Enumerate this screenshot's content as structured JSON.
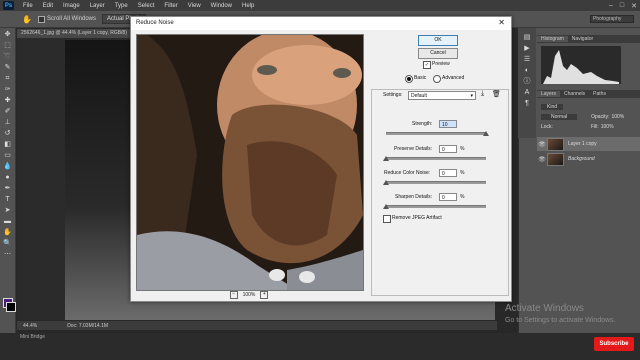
{
  "menubar": {
    "logo": "Ps",
    "items": [
      "File",
      "Edit",
      "Image",
      "Layer",
      "Type",
      "Select",
      "Filter",
      "View",
      "Window",
      "Help"
    ],
    "window_controls": [
      "–",
      "□",
      "✕"
    ]
  },
  "options": {
    "scroll_all": "Scroll All Windows",
    "actual_pixels": "Actual Pixels",
    "workspace": "Photography"
  },
  "document": {
    "tab": "2562646_1.jpg @ 44.4% (Layer 1 copy, RGB/8)",
    "zoom": "44.4%",
    "doc_size": "Doc: 7.03M/14.1M",
    "mini_bridge": "Mini Bridge"
  },
  "panels": {
    "histogram_tabs": [
      "Histogram",
      "Navigator"
    ],
    "layers_tabs": [
      "Layers",
      "Channels",
      "Paths"
    ],
    "kind": "Kind",
    "blend": "Normal",
    "opacity_label": "Opacity:",
    "opacity": "100%",
    "lock_label": "Lock:",
    "fill_label": "Fill:",
    "fill": "100%",
    "layers": [
      "Layer 1 copy",
      "Background"
    ]
  },
  "dialog": {
    "title": "Reduce Noise",
    "close": "✕",
    "ok": "OK",
    "cancel": "Cancel",
    "preview": "Preview",
    "basic": "Basic",
    "advanced": "Advanced",
    "settings_label": "Settings:",
    "settings_value": "Default",
    "strength_label": "Strength:",
    "strength": "10",
    "preserve_label": "Preserve Details:",
    "preserve": "0",
    "color_noise_label": "Reduce Color Noise:",
    "color_noise": "0",
    "sharpen_label": "Sharpen Details:",
    "sharpen": "0",
    "percent": "%",
    "jpeg": "Remove JPEG Artifact",
    "zoom": "100%",
    "zoom_out": "−",
    "zoom_in": "+",
    "sliders": {
      "strength": 1.0,
      "preserve": 0.0,
      "color_noise": 0.0,
      "sharpen": 0.0
    }
  },
  "watermark": {
    "line1": "Activate Windows",
    "line2": "Go to Settings to activate Windows."
  },
  "subscribe": "Subscribe"
}
